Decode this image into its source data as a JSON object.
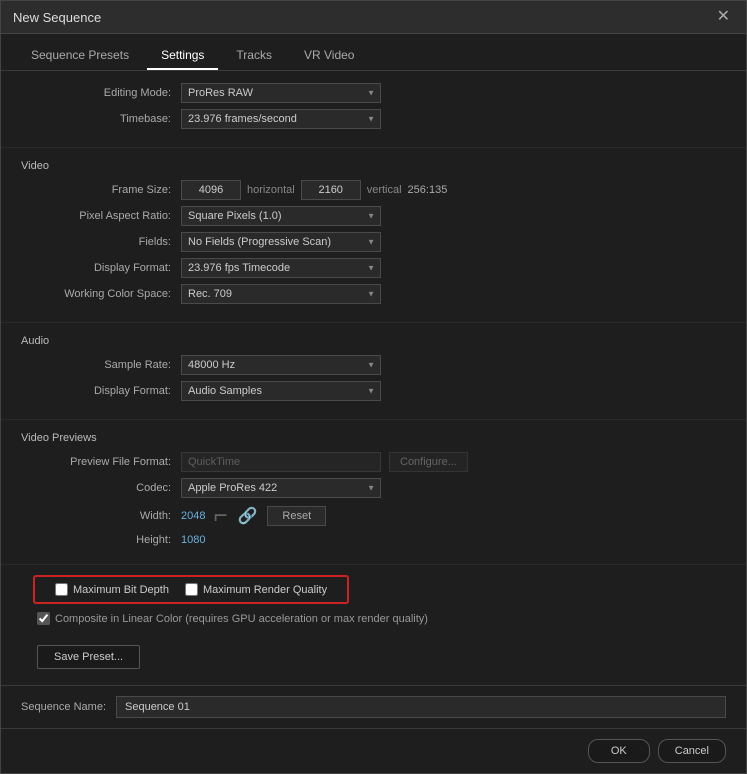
{
  "dialog": {
    "title": "New Sequence",
    "close_label": "✕"
  },
  "tabs": [
    {
      "id": "sequence-presets",
      "label": "Sequence Presets",
      "active": false
    },
    {
      "id": "settings",
      "label": "Settings",
      "active": true
    },
    {
      "id": "tracks",
      "label": "Tracks",
      "active": false
    },
    {
      "id": "vr-video",
      "label": "VR Video",
      "active": false
    }
  ],
  "settings": {
    "editing_mode_label": "Editing Mode:",
    "editing_mode_value": "ProRes RAW",
    "timebase_label": "Timebase:",
    "timebase_value": "23.976 frames/second"
  },
  "video_section": {
    "label": "Video",
    "frame_size_label": "Frame Size:",
    "frame_size_h": "4096",
    "frame_size_h_label": "horizontal",
    "frame_size_v": "2160",
    "frame_size_v_label": "vertical",
    "frame_size_ratio": "256:135",
    "pixel_aspect_label": "Pixel Aspect Ratio:",
    "pixel_aspect_value": "Square Pixels (1.0)",
    "fields_label": "Fields:",
    "fields_value": "No Fields (Progressive Scan)",
    "display_format_label": "Display Format:",
    "display_format_value": "23.976 fps Timecode",
    "working_color_label": "Working Color Space:",
    "working_color_value": "Rec. 709"
  },
  "audio_section": {
    "label": "Audio",
    "sample_rate_label": "Sample Rate:",
    "sample_rate_value": "48000 Hz",
    "display_format_label": "Display Format:",
    "display_format_value": "Audio Samples"
  },
  "video_previews": {
    "label": "Video Previews",
    "preview_file_format_label": "Preview File Format:",
    "preview_file_format_value": "QuickTime",
    "configure_label": "Configure...",
    "codec_label": "Codec:",
    "codec_value": "Apple ProRes 422",
    "width_label": "Width:",
    "width_value": "2048",
    "height_label": "Height:",
    "height_value": "1080",
    "reset_label": "Reset",
    "max_bit_depth_label": "Maximum Bit Depth",
    "max_render_quality_label": "Maximum Render Quality",
    "composite_label": "Composite in Linear Color (requires GPU acceleration or max render quality)"
  },
  "save_preset": {
    "label": "Save Preset..."
  },
  "sequence_name": {
    "label": "Sequence Name:",
    "value": "Sequence 01"
  },
  "buttons": {
    "ok": "OK",
    "cancel": "Cancel"
  }
}
